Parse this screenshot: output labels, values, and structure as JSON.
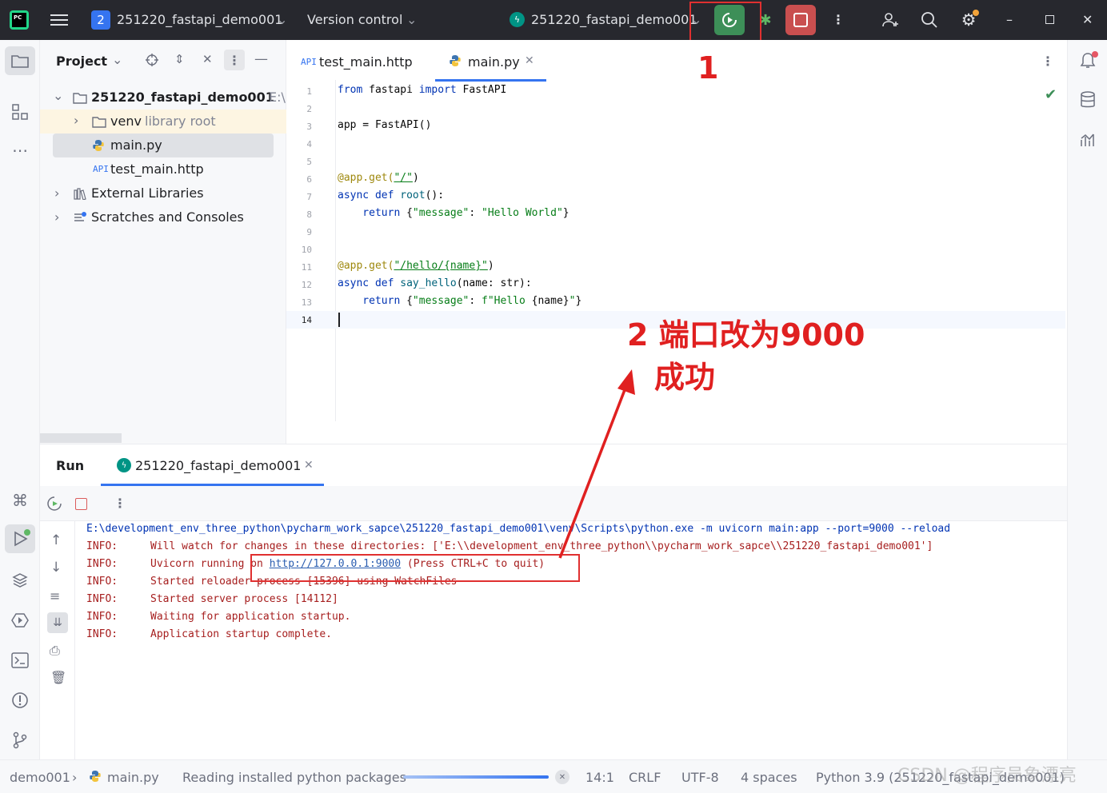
{
  "titlebar": {
    "project_badge": "2",
    "project_name": "251220_fastapi_demo001",
    "version_control": "Version control",
    "run_config": "251220_fastapi_demo001"
  },
  "project_panel": {
    "title": "Project",
    "tree": {
      "root": "251220_fastapi_demo001",
      "root_path": "E:\\",
      "venv": "venv",
      "venv_hint": "library root",
      "main": "main.py",
      "http_badge": "API",
      "http": "test_main.http",
      "ext_libs": "External Libraries",
      "scratches": "Scratches and Consoles"
    }
  },
  "editor": {
    "tabs": [
      {
        "badge": "API",
        "label": "test_main.http"
      },
      {
        "label": "main.py"
      }
    ],
    "line_numbers": [
      "1",
      "2",
      "3",
      "4",
      "5",
      "6",
      "7",
      "8",
      "9",
      "10",
      "11",
      "12",
      "13",
      "14"
    ],
    "code": {
      "l1_from": "from",
      "l1_mod": " fastapi ",
      "l1_import": "import",
      "l1_name": " FastAPI",
      "l3": "app = FastAPI()",
      "l6_dec": "@app.get(",
      "l6_str": "\"/\"",
      "l6_end": ")",
      "l7_kw": "async def ",
      "l7_fn": "root",
      "l7_end": "():",
      "l8_kw": "    return ",
      "l8_a": "{",
      "l8_k": "\"message\"",
      "l8_b": ": ",
      "l8_v": "\"Hello World\"",
      "l8_c": "}",
      "l11_dec": "@app.get(",
      "l11_str": "\"/hello/{name}\"",
      "l11_end": ")",
      "l12_kw": "async def ",
      "l12_fn": "say_hello",
      "l12_end": "(name: str):",
      "l13_kw": "    return ",
      "l13_a": "{",
      "l13_k": "\"message\"",
      "l13_b": ": ",
      "l13_v": "f\"Hello ",
      "l13_n": "{name}",
      "l13_v2": "\"",
      "l13_c": "}"
    }
  },
  "annotations": {
    "label1": "1",
    "label2_line1": "2 端口改为9000",
    "label2_line2": "成功"
  },
  "run_panel": {
    "tab_run": "Run",
    "tab_config": "251220_fastapi_demo001",
    "cmd": "E:\\development_env_three_python\\pycharm_work_sapce\\251220_fastapi_demo001\\venv\\Scripts\\python.exe -m uvicorn main:app --port=9000 --reload",
    "lines": [
      {
        "level": "INFO:",
        "msg": "Will watch for changes in these directories: ['E:\\\\development_env_three_python\\\\pycharm_work_sapce\\\\251220_fastapi_demo001']"
      },
      {
        "level": "INFO:",
        "msg_pre": "Uvicorn running on ",
        "link": "http://127.0.0.1:9000",
        "msg_post": " (Press CTRL+C to quit)"
      },
      {
        "level": "INFO:",
        "msg": "Started reloader process [15396] using WatchFiles"
      },
      {
        "level": "INFO:",
        "msg": "Started server process [14112]"
      },
      {
        "level": "INFO:",
        "msg": "Waiting for application startup."
      },
      {
        "level": "INFO:",
        "msg": "Application startup complete."
      }
    ]
  },
  "status": {
    "crumb1": "demo001",
    "crumb2": "main.py",
    "progress_text": "Reading installed python packages",
    "progress": 1.0,
    "pos": "14:1",
    "eol": "CRLF",
    "enc": "UTF-8",
    "indent": "4 spaces",
    "interpreter": "Python 3.9 (251220_fastapi_demo001)",
    "watermark": "CSDN @程序员象漂亮"
  }
}
